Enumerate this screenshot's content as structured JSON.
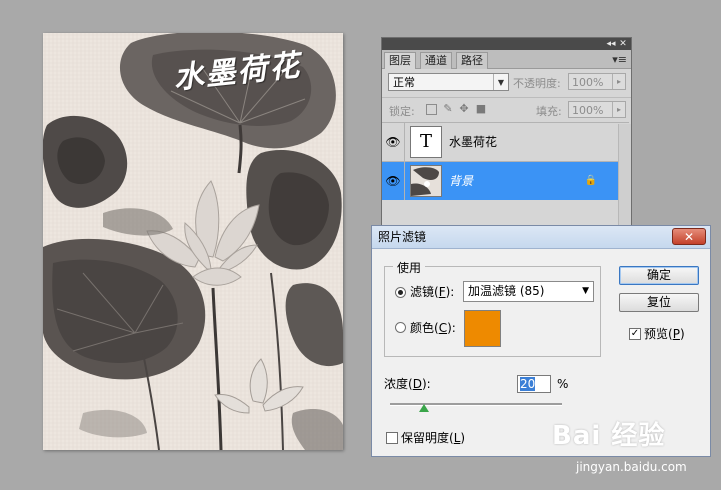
{
  "canvas": {
    "title_text": "水墨荷花"
  },
  "layers_panel": {
    "tabs": [
      "图层",
      "通道",
      "路径"
    ],
    "active_tab": "图层",
    "blend_mode": "正常",
    "opacity_label": "不透明度:",
    "opacity_value": "100%",
    "lock_label": "锁定:",
    "fill_label": "填充:",
    "fill_value": "100%",
    "layers": [
      {
        "name": "水墨荷花",
        "thumb_glyph": "T",
        "selected": false
      },
      {
        "name": "背景",
        "selected": true
      }
    ]
  },
  "dialog": {
    "title": "照片滤镜",
    "use_label": "使用",
    "filter_label": "滤镜(F):",
    "filter_prefix": "滤镜(",
    "filter_key": "F",
    "filter_suffix": "):",
    "filter_value": "加温滤镜 (85)",
    "color_prefix": "颜色(",
    "color_key": "C",
    "color_suffix": "):",
    "color_swatch": "#ee8a00",
    "ok_label": "确定",
    "reset_label": "复位",
    "preview_prefix": "预览(",
    "preview_key": "P",
    "preview_suffix": ")",
    "preview_checked": true,
    "density_prefix": "浓度(",
    "density_key": "D",
    "density_suffix": "):",
    "density_value": "20",
    "density_unit": "%",
    "preserve_prefix": "保留明度(",
    "preserve_key": "L",
    "preserve_suffix": ")",
    "preserve_checked": false
  },
  "watermark": {
    "brand": "Bai 经验",
    "url": "jingyan.baidu.com"
  }
}
